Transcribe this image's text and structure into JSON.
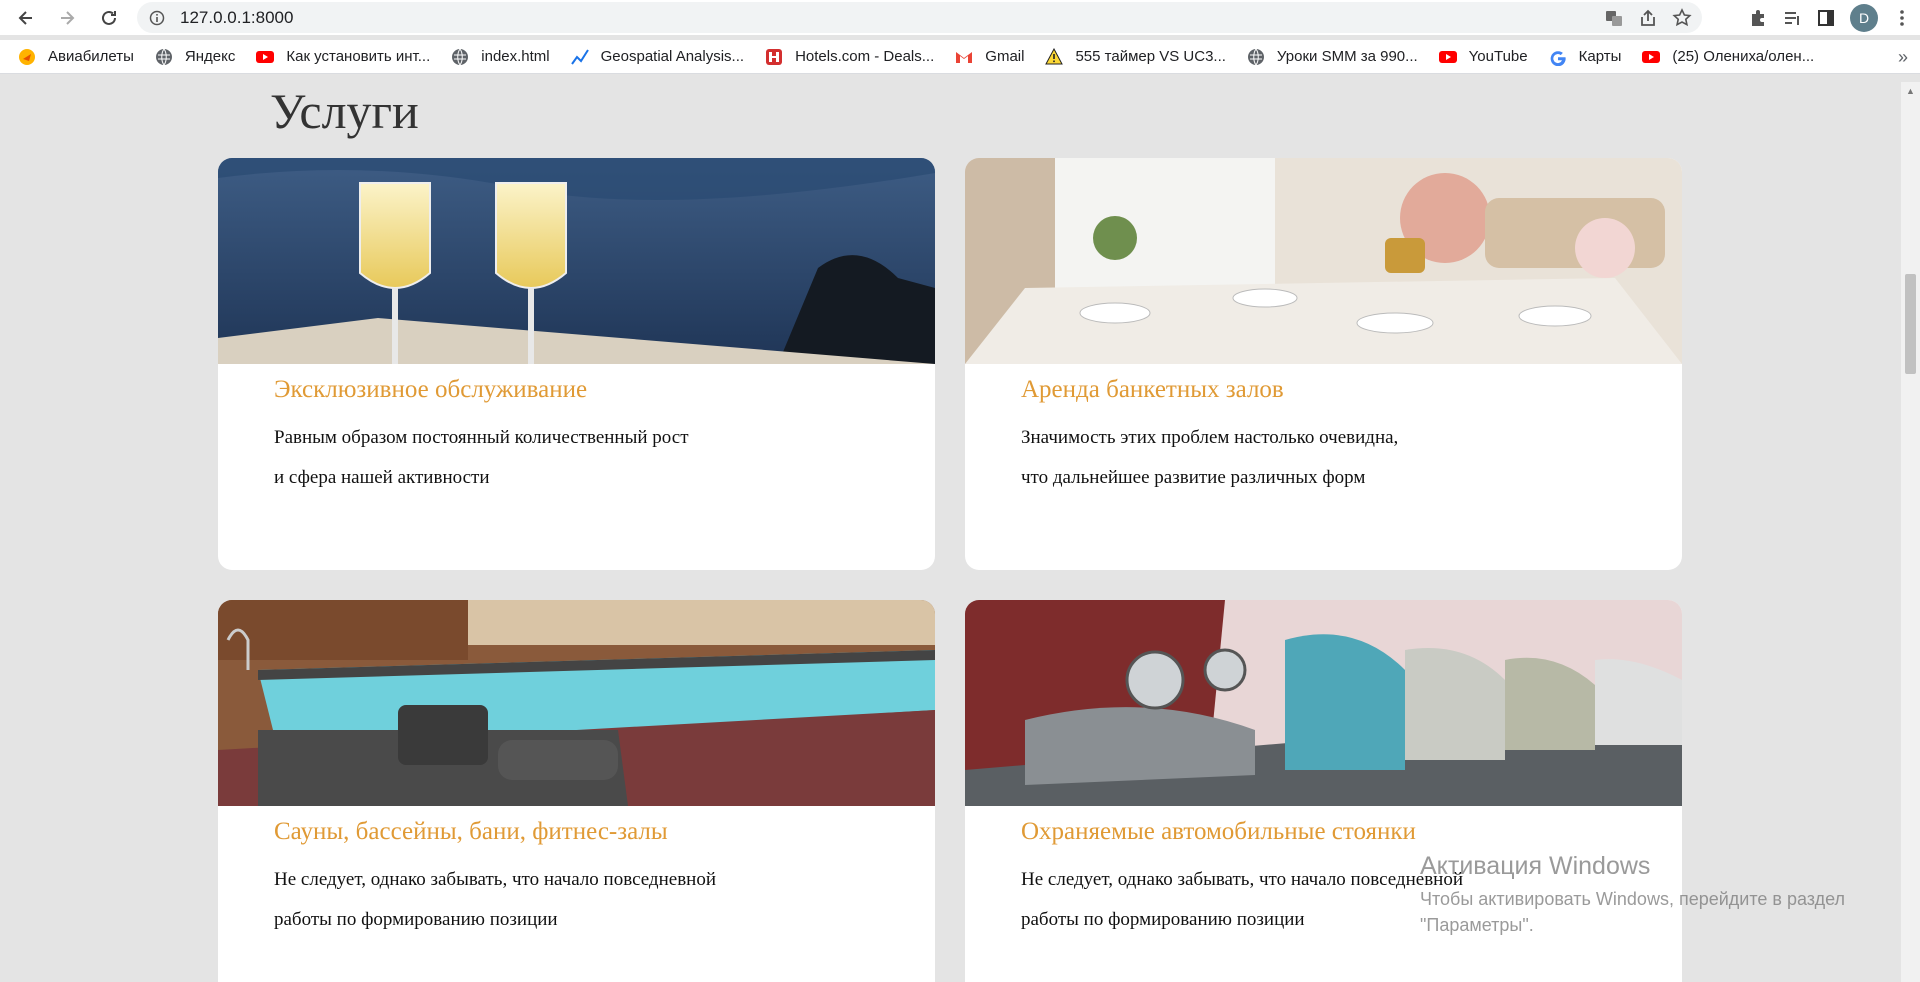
{
  "browser": {
    "url": "127.0.0.1:8000",
    "profile_initial": "D",
    "bookmarks": [
      {
        "label": "Авиабилеты",
        "icon": "aviasales-icon"
      },
      {
        "label": "Яндекс",
        "icon": "globe-icon"
      },
      {
        "label": "Как установить инт...",
        "icon": "youtube-icon"
      },
      {
        "label": "index.html",
        "icon": "globe-icon"
      },
      {
        "label": "Geospatial Analysis...",
        "icon": "chart-icon"
      },
      {
        "label": "Hotels.com - Deals...",
        "icon": "hotels-icon"
      },
      {
        "label": "Gmail",
        "icon": "gmail-icon"
      },
      {
        "label": "555 таймер VS UC3...",
        "icon": "warning-icon"
      },
      {
        "label": "Уроки SMM за 990...",
        "icon": "globe-icon"
      },
      {
        "label": "YouTube",
        "icon": "youtube-icon"
      },
      {
        "label": "Карты",
        "icon": "google-icon"
      },
      {
        "label": "(25) Олениха/олен...",
        "icon": "youtube-icon"
      }
    ],
    "bookmarks_more": "»"
  },
  "page": {
    "section_title": "Услуги",
    "cards": [
      {
        "title": "Эксклюзивное обслуживание",
        "line1": "Равным образом постоянный количественный рост",
        "line2": "и сфера нашей активности",
        "image": "champagne-image"
      },
      {
        "title": "Аренда банкетных залов",
        "line1": "Значимость этих проблем настолько очевидна,",
        "line2": "что дальнейшее развитие различных форм",
        "image": "dining-room-image"
      },
      {
        "title": "Сауны, бассейны, бани, фитнес-залы",
        "line1": "Не следует, однако забывать, что начало повседневной",
        "line2": "работы по формированию позиции",
        "image": "pool-image"
      },
      {
        "title": "Охраняемые автомобильные стоянки",
        "line1": "Не следует, однако забывать, что начало повседневной",
        "line2": "работы по формированию позиции",
        "image": "cars-image"
      }
    ]
  },
  "watermark": {
    "title": "Активация Windows",
    "line1": "Чтобы активировать Windows, перейдите в раздел",
    "line2": "\"Параметры\"."
  },
  "colors": {
    "accent": "#e09a35",
    "page_bg": "#e4e4e4"
  }
}
